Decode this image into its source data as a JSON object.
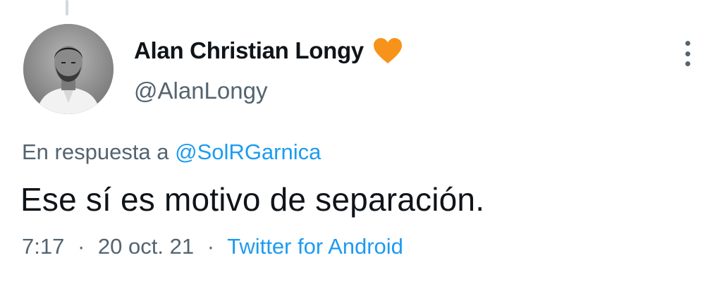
{
  "tweet": {
    "display_name": "Alan Christian Longy",
    "handle": "@AlanLongy",
    "badge_icon": "orange-heart-icon",
    "badge_color": "#f7931a",
    "avatar_icon": "profile-photo",
    "more_icon": "more-vertical-icon",
    "reply_prefix": "En respuesta a",
    "reply_mention": "@SolRGarnica",
    "text": "Ese sí es motivo de separación.",
    "time": "7:17",
    "date": "20 oct. 21",
    "separator": "·",
    "source": "Twitter for Android"
  },
  "colors": {
    "primary_text": "#0f1419",
    "secondary_text": "#536471",
    "link": "#1d9bf0",
    "thread_line": "#cfd9de"
  }
}
